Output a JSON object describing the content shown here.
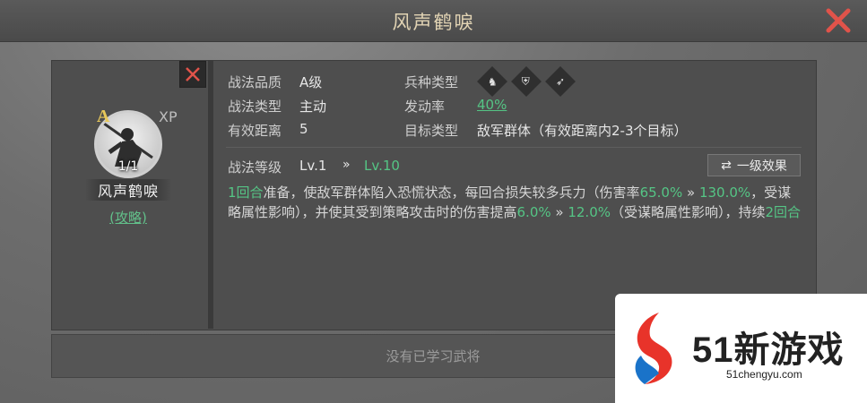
{
  "window": {
    "title": "风声鹤唳"
  },
  "skill_card": {
    "grade": "A",
    "xp_label": "XP",
    "count": "1/1",
    "name": "风声鹤唳",
    "guide_link": "(攻略)"
  },
  "attributes": {
    "quality_label": "战法品质",
    "quality_value": "A级",
    "type_label": "战法类型",
    "type_value": "主动",
    "range_label": "有效距离",
    "range_value": "5",
    "troop_label": "兵种类型",
    "rate_label": "发动率",
    "rate_value": "40%",
    "target_label": "目标类型",
    "target_value": "敌军群体（有效距离内2-3个目标）"
  },
  "troop_icons": [
    "cavalry-icon",
    "shield-icon",
    "archer-icon"
  ],
  "level": {
    "label": "战法等级",
    "current": "Lv.1",
    "arrow": "»",
    "max": "Lv.10",
    "effect_button": "一级效果"
  },
  "description": {
    "p1": "1回合",
    "p2": "准备，使敌军群体陷入恐慌状态，每回合损失较多兵力（伤害率",
    "p3": "65.0%",
    "p4": " » ",
    "p5": "130.0%",
    "p6": "，受谋略属性影响），并使其受到策略攻击时的伤害提高",
    "p7": "6.0%",
    "p8": " » ",
    "p9": "12.0%",
    "p10": "（受谋略属性影响），持续",
    "p11": "2回合"
  },
  "bottom": {
    "text": "没有已学习武将"
  },
  "watermark": {
    "name": "51新游戏",
    "url": "51chengyu.com"
  },
  "colors": {
    "highlight": "#55c585",
    "title": "#e2d4b4",
    "grade": "#e8c85a",
    "close": "#e0534a"
  }
}
